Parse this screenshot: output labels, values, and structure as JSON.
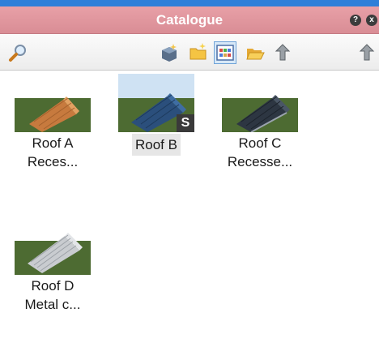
{
  "window": {
    "title": "Catalogue"
  },
  "title_buttons": [
    {
      "name": "help-icon",
      "glyph": "?"
    },
    {
      "name": "close-icon",
      "glyph": "x"
    }
  ],
  "toolbar": {
    "tools": [
      {
        "name": "search-icon"
      },
      {
        "name": "add-component-icon"
      },
      {
        "name": "new-folder-icon"
      },
      {
        "name": "view-grid-icon",
        "active": true
      },
      {
        "name": "open-folder-icon"
      },
      {
        "name": "import-icon"
      },
      {
        "name": "export-icon"
      }
    ]
  },
  "items": [
    {
      "line1": "Roof A",
      "line2": "Reces...",
      "roof_color": "#c77a3e",
      "badge": ""
    },
    {
      "line1": "Roof B",
      "line2": "",
      "roof_color": "#2b4f7c",
      "badge": "S",
      "selected": true
    },
    {
      "line1": "Roof C",
      "line2": "Recesse...",
      "roof_color": "#2d3642",
      "badge": ""
    },
    {
      "line1": "Roof D",
      "line2": "Metal c...",
      "roof_color": "#c9ccd0",
      "badge": ""
    }
  ],
  "colors": {
    "titlebar": "#dc8e97",
    "frame_accent": "#2f7fd9",
    "grass": "#4d6b32"
  }
}
